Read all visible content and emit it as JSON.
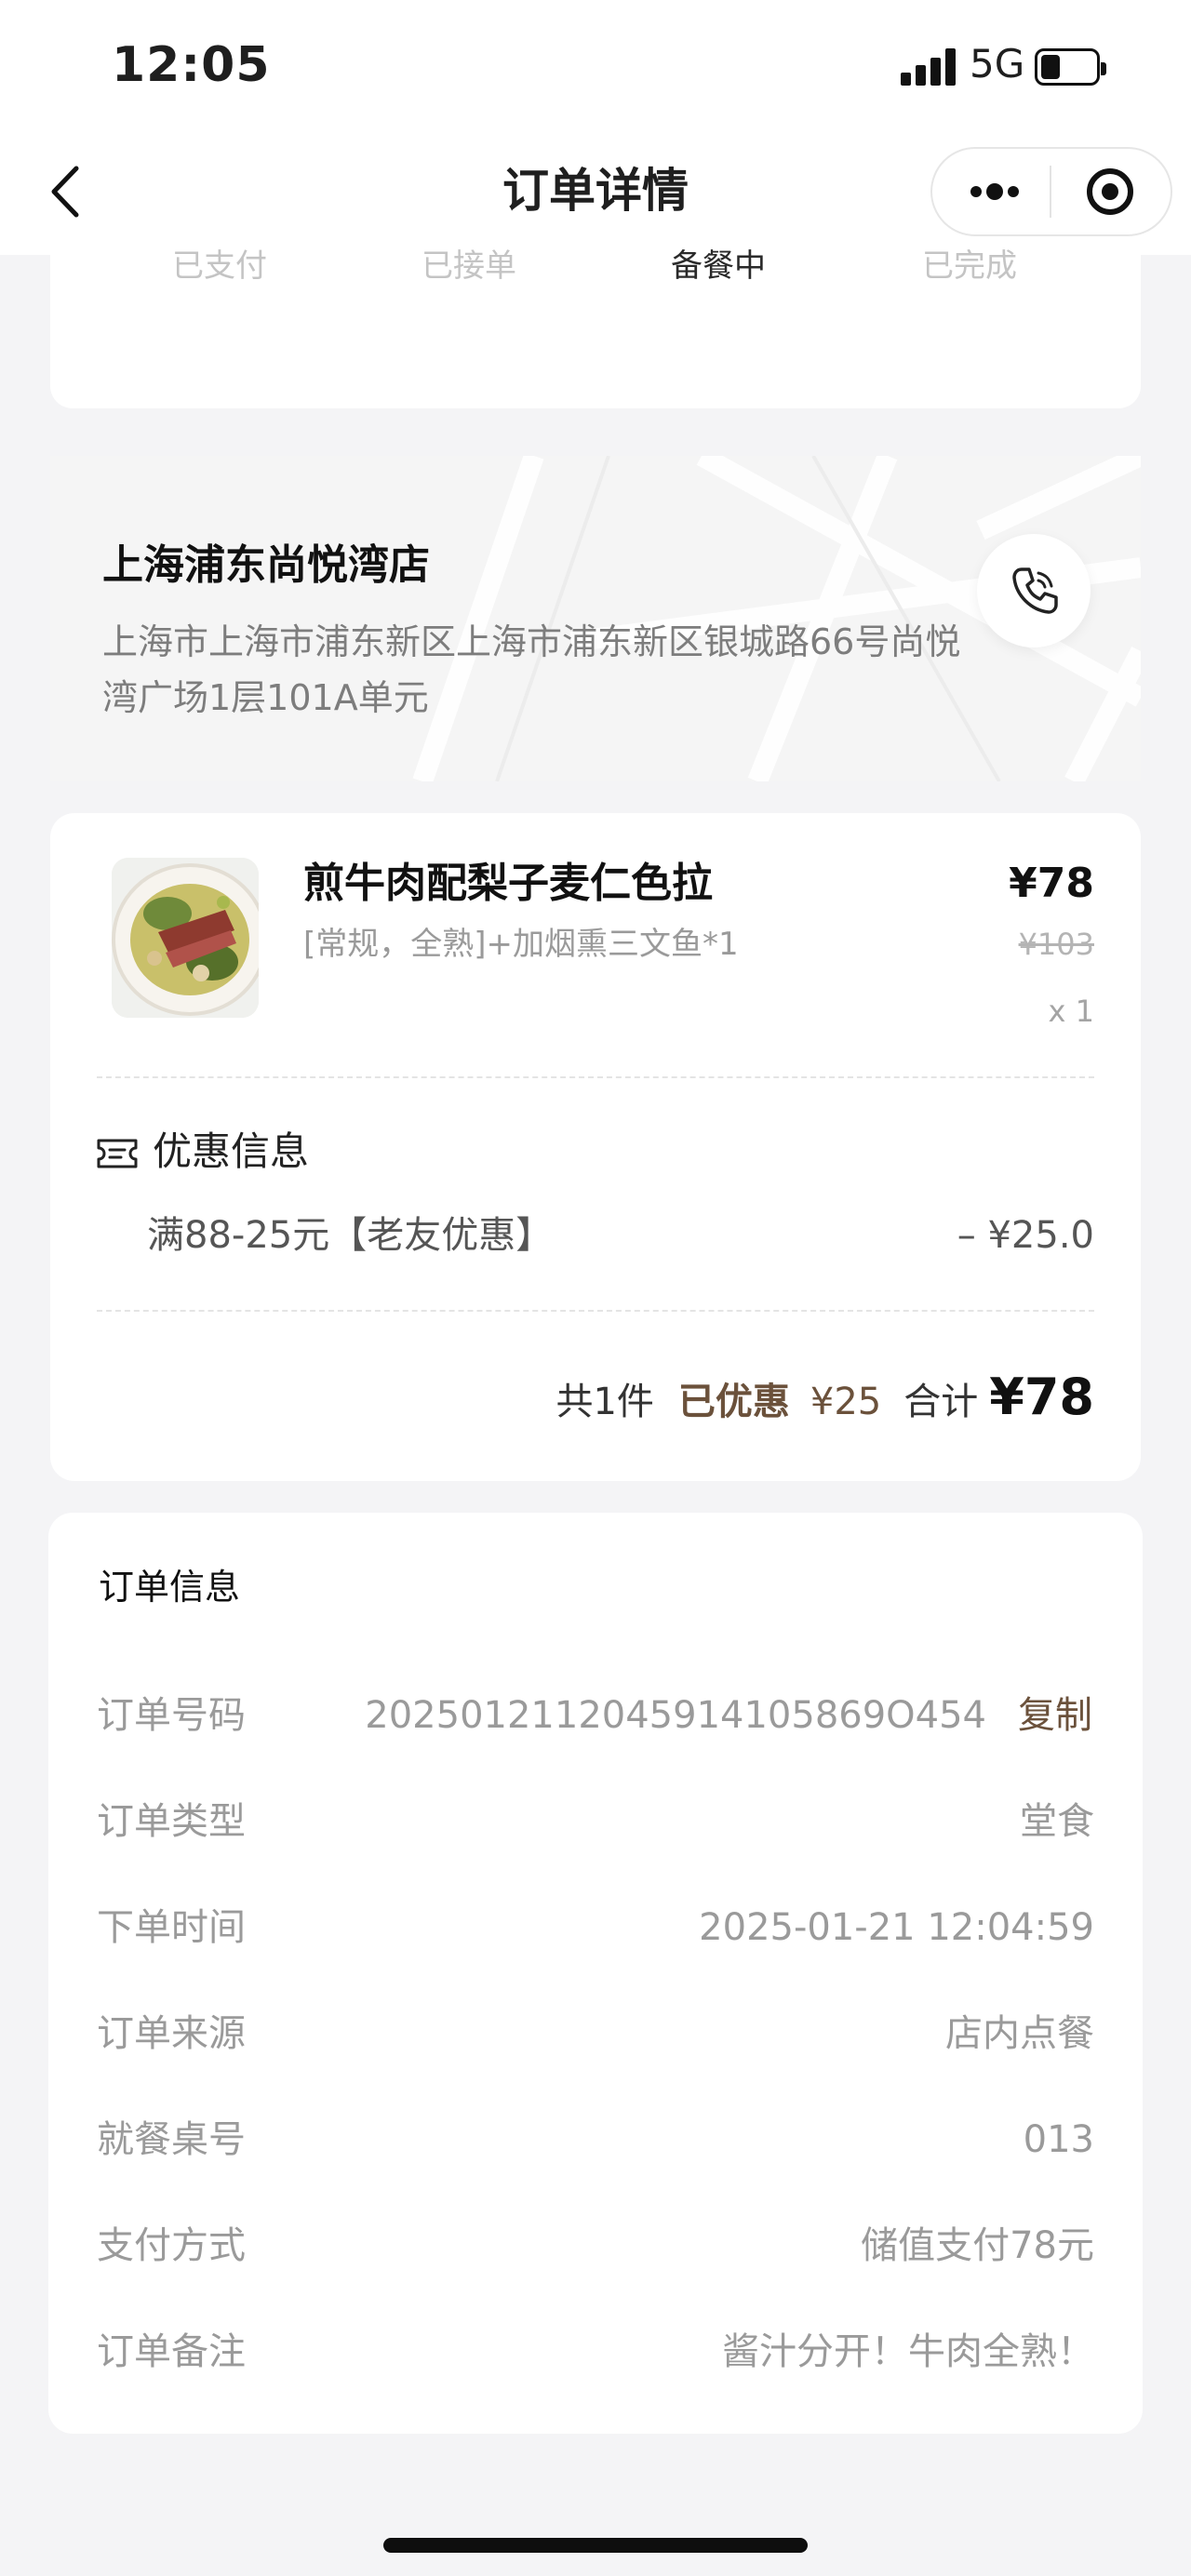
{
  "status_bar": {
    "time": "12:05",
    "network": "5G"
  },
  "nav": {
    "title": "订单详情"
  },
  "progress": {
    "steps": [
      "已支付",
      "已接单",
      "备餐中",
      "已完成"
    ],
    "current_step": "备餐中"
  },
  "store": {
    "name": "上海浦东尚悦湾店",
    "address": "上海市上海市浦东新区上海市浦东新区银城路66号尚悦湾广场1层101A单元"
  },
  "items": [
    {
      "name": "煎牛肉配梨子麦仁色拉",
      "spec": "[常规，全熟]+加烟熏三文鱼*1",
      "price": "¥78",
      "original_price": "¥103",
      "quantity": "x 1"
    }
  ],
  "discount": {
    "title": "优惠信息",
    "name": "满88-25元【老友优惠】",
    "amount": "– ¥25.0"
  },
  "summary": {
    "count": "共1件",
    "saved_label": "已优惠",
    "saved_amount": "¥25",
    "total_label": "合计",
    "total_value": "¥78"
  },
  "order_info": {
    "title": "订单信息",
    "copy_label": "复制",
    "rows": [
      {
        "label": "订单号码",
        "value": "2025012112045914105869O454"
      },
      {
        "label": "订单类型",
        "value": "堂食"
      },
      {
        "label": "下单时间",
        "value": "2025-01-21 12:04:59"
      },
      {
        "label": "订单来源",
        "value": "店内点餐"
      },
      {
        "label": "就餐桌号",
        "value": "013"
      },
      {
        "label": "支付方式",
        "value": "储值支付78元"
      },
      {
        "label": "订单备注",
        "value": "酱汁分开！牛肉全熟！"
      }
    ]
  },
  "colors": {
    "accent_brown": "#6b513b",
    "page_bg": "#f4f4f6",
    "muted_text": "#9a9a9a"
  }
}
